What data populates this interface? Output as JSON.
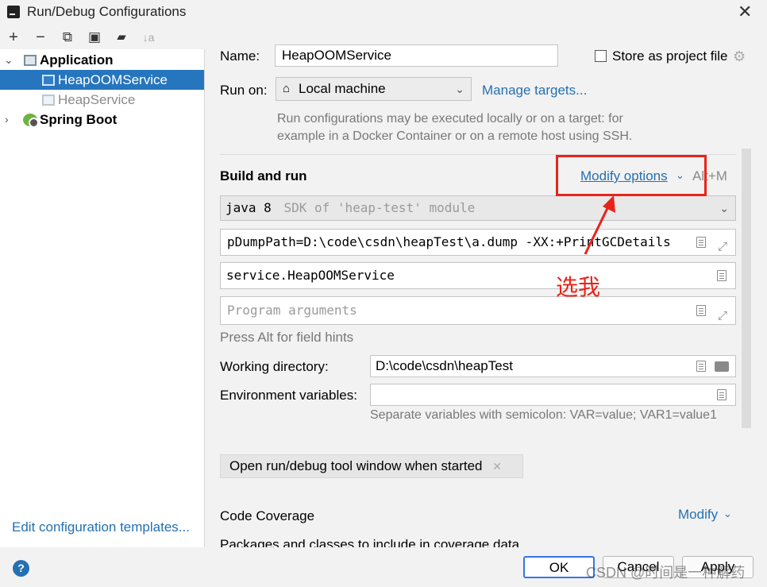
{
  "window": {
    "title": "Run/Debug Configurations",
    "close_glyph": "✕"
  },
  "toolbar": {
    "add": "+",
    "remove": "−",
    "copy": "⧉",
    "save": "▣",
    "folder": "▰",
    "sort": "↓a"
  },
  "tree": {
    "application": {
      "label": "Application",
      "expanded": true
    },
    "items": [
      {
        "label": "HeapOOMService",
        "selected": true
      },
      {
        "label": "HeapService",
        "selected": false
      }
    ],
    "spring_boot": {
      "label": "Spring Boot",
      "expanded": false
    }
  },
  "left_footer": {
    "edit_templates": "Edit configuration templates..."
  },
  "form": {
    "name_label": "Name:",
    "name_value": "HeapOOMService",
    "store_label": "Store as project file",
    "run_on_label": "Run on:",
    "run_on_value": "Local machine",
    "manage_targets": "Manage targets...",
    "run_on_hint_1": "Run configurations may be executed locally or on a target: for",
    "run_on_hint_2": "example in a Docker Container or on a remote host using SSH.",
    "build_and_run": "Build and run",
    "modify_options": "Modify options",
    "modify_shortcut": "Alt+M",
    "sdk_main": "java 8",
    "sdk_detail": "SDK of 'heap-test' module",
    "vm_options": "pDumpPath=D:\\code\\csdn\\heapTest\\a.dump -XX:+PrintGCDetails",
    "main_class": "service.HeapOOMService",
    "program_args_placeholder": "Program arguments",
    "field_hint": "Press Alt for field hints",
    "working_dir_label": "Working directory:",
    "working_dir_value": "D:\\code\\csdn\\heapTest",
    "env_label": "Environment variables:",
    "env_value": "",
    "env_hint": "Separate variables with semicolon: VAR=value; VAR1=value1",
    "open_tool_window": "Open run/debug tool window when started",
    "code_coverage": "Code Coverage",
    "modify": "Modify",
    "packages_text": "Packages and classes to include in coverage data"
  },
  "annotation": {
    "text": "选我",
    "color": "#e8241a"
  },
  "buttons": {
    "ok": "OK",
    "cancel": "Cancel",
    "apply": "Apply",
    "help": "?"
  },
  "watermark": "CSDN @时间是一种解药",
  "colors": {
    "accent": "#2675bf",
    "link": "#2470b3",
    "annotation": "#e8241a"
  }
}
